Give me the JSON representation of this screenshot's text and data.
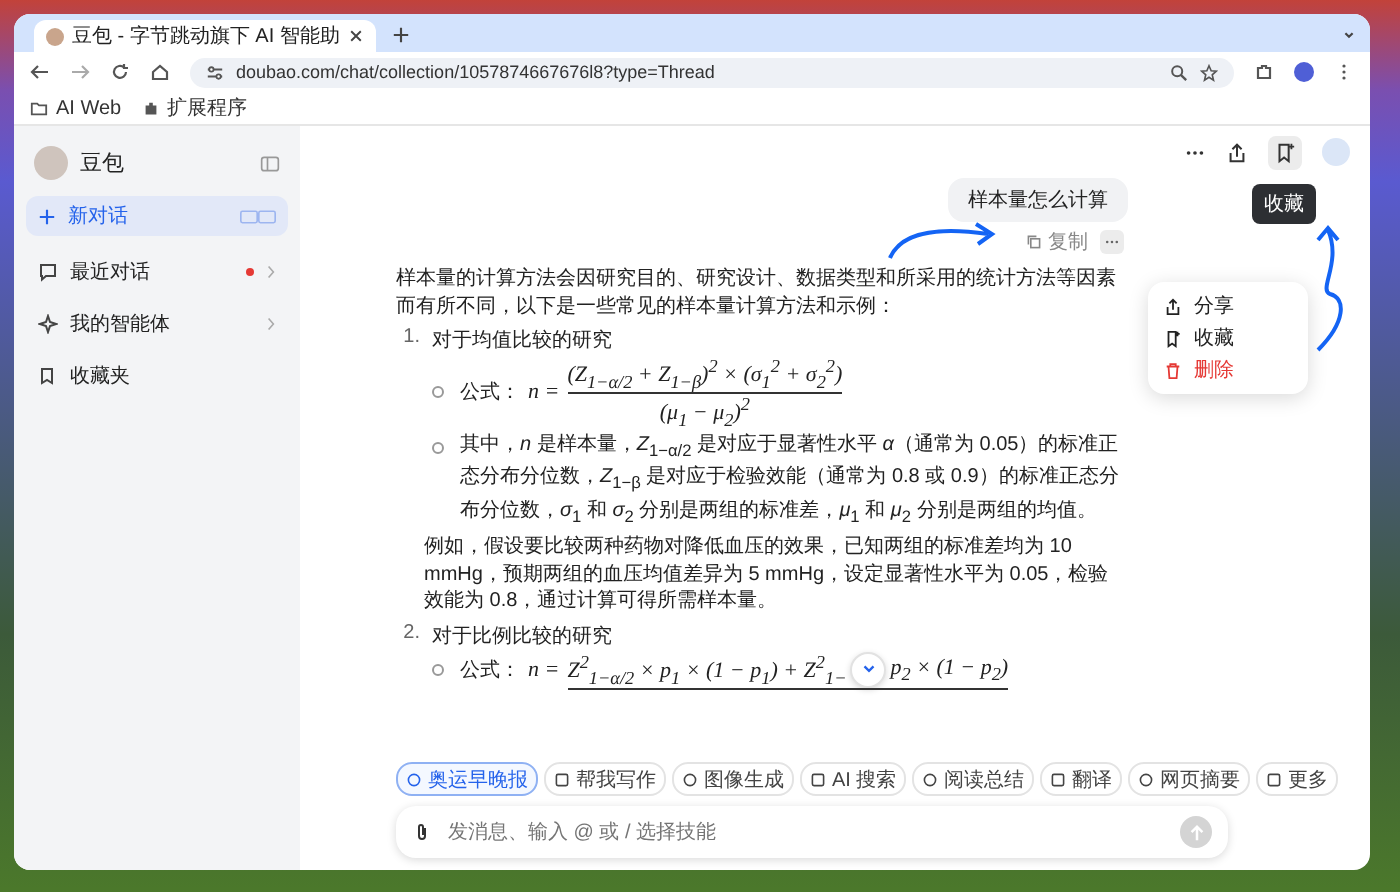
{
  "browser": {
    "tab": {
      "title": "豆包 - 字节跳动旗下 AI 智能助"
    },
    "address": "doubao.com/chat/collection/1057874667676l8?type=Thread",
    "bookmarks": [
      {
        "label": "AI Web"
      },
      {
        "label": "扩展程序"
      }
    ]
  },
  "sidebar": {
    "app_name": "豆包",
    "new_chat": "新对话",
    "items": [
      {
        "label": "最近对话",
        "unread": true,
        "expandable": true
      },
      {
        "label": "我的智能体",
        "unread": false,
        "expandable": true
      },
      {
        "label": "收藏夹",
        "unread": false,
        "expandable": false
      }
    ]
  },
  "header": {
    "tooltip": "收藏"
  },
  "user_message": {
    "text": "样本量怎么计算",
    "copy_label": "复制"
  },
  "message_menu": [
    {
      "label": "分享",
      "kind": "share"
    },
    {
      "label": "收藏",
      "kind": "bookmark"
    },
    {
      "label": "删除",
      "kind": "delete"
    }
  ],
  "answer": {
    "intro": "样本量的计算方法会因研究目的、研究设计、数据类型和所采用的统计方法等因素而有所不同，以下是一些常见的样本量计算方法和示例：",
    "sections": [
      {
        "number": "1.",
        "title": "对于均值比较的研究",
        "formula": {
          "label": "公式：",
          "lhs": "n =",
          "numerator": [
            "(Z$_{1−α/2}$ + Z$_{1−β}$)$^{2}$ × (σ$_{1}$$^{2}$ + σ$_{2}$$^{2}$)"
          ],
          "denominator": "(μ$_{1}$ − μ$_{2}$)$^{2}$"
        },
        "note": "其中，*n* 是样本量，*Z*$_{1−α/2}$ 是对应于显著性水平 *α*（通常为 0.05）的标准正态分布分位数，*Z*$_{1−β}$ 是对应于检验效能（通常为 0.8 或 0.9）的标准正态分布分位数，*σ*$_{1}$ 和 *σ*$_{2}$ 分别是两组的标准差，*μ*$_{1}$ 和 *μ*$_{2}$ 分别是两组的均值。",
        "example": "例如，假设要比较两种药物对降低血压的效果，已知两组的标准差均为 10 mmHg，预期两组的血压均值差异为 5 mmHg，设定显著性水平为 0.05，检验效能为 0.8，通过计算可得所需样本量。"
      },
      {
        "number": "2.",
        "title": "对于比例比较的研究",
        "formula": {
          "label": "公式：",
          "lhs": "n =",
          "numerator": [
            "Z$^{2}$$_{1−α/2}$ × p$_{1}$ × (1 − p$_{1}$) + Z$^{2}$$_{1−}$",
            "p$_{2}$ × (1 − p$_{2}$)"
          ]
        }
      }
    ]
  },
  "skills": [
    {
      "label": "奥运早晚报",
      "selected": true
    },
    {
      "label": "帮我写作",
      "selected": false
    },
    {
      "label": "图像生成",
      "selected": false
    },
    {
      "label": "AI 搜索",
      "selected": false
    },
    {
      "label": "阅读总结",
      "selected": false
    },
    {
      "label": "翻译",
      "selected": false
    },
    {
      "label": "网页摘要",
      "selected": false
    },
    {
      "label": "更多",
      "selected": false
    }
  ],
  "composer": {
    "placeholder": "发消息、输入 @ 或 / 选择技能",
    "send_disabled": true
  }
}
